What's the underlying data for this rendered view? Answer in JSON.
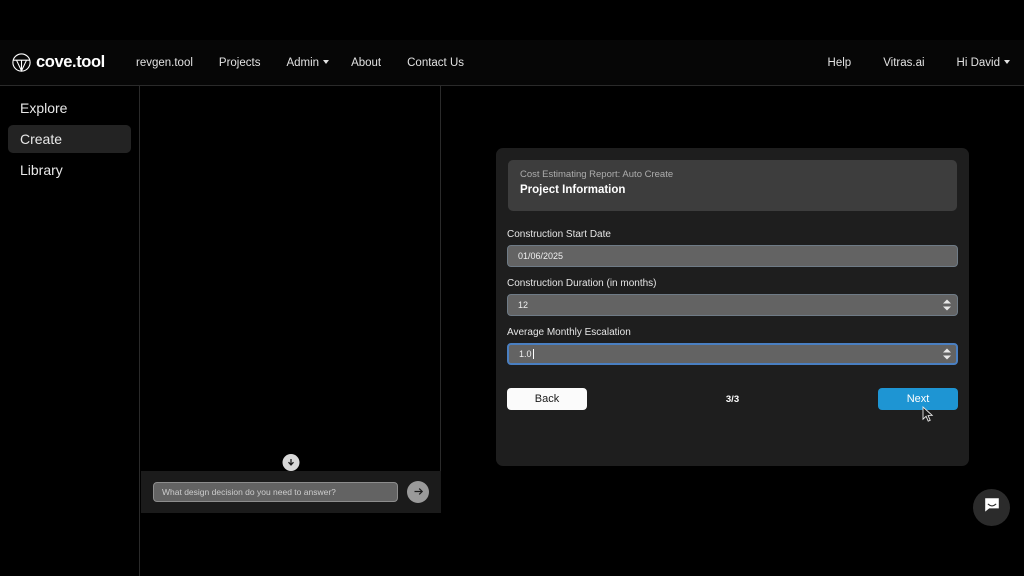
{
  "header": {
    "brand": "cove.tool",
    "brand_icon": "cove-logo-icon",
    "left_links": [
      {
        "label": "revgen.tool",
        "has_caret": false
      },
      {
        "label": "Projects",
        "has_caret": false
      },
      {
        "label": "Admin",
        "has_caret": true
      },
      {
        "label": "About",
        "has_caret": false
      },
      {
        "label": "Contact Us",
        "has_caret": false
      }
    ],
    "right_links": [
      {
        "label": "Help",
        "has_caret": false
      },
      {
        "label": "Vitras.ai",
        "has_caret": false
      },
      {
        "label": "Hi David",
        "has_caret": true
      }
    ]
  },
  "sidebar": {
    "items": [
      {
        "label": "Explore",
        "active": false
      },
      {
        "label": "Create",
        "active": true
      },
      {
        "label": "Library",
        "active": false
      }
    ]
  },
  "chat_panel": {
    "scroll_down_icon": "arrow-down-circle-icon",
    "input_placeholder": "What design decision do you need to answer?",
    "input_value": "",
    "send_icon": "arrow-right-icon"
  },
  "modal": {
    "subtitle": "Cost Estimating Report: Auto Create",
    "title": "Project Information",
    "fields": [
      {
        "label": "Construction Start Date",
        "value": "01/06/2025",
        "type": "date",
        "focused": false,
        "spinner": false
      },
      {
        "label": "Construction Duration (in months)",
        "value": "12",
        "type": "number",
        "focused": false,
        "spinner": true
      },
      {
        "label": "Average Monthly Escalation",
        "value": "1.0",
        "type": "number",
        "focused": true,
        "spinner": true
      }
    ],
    "back_label": "Back",
    "step_indicator": "3/3",
    "next_label": "Next"
  },
  "launcher": {
    "icon": "chat-bubble-icon"
  },
  "colors": {
    "page_background": "#000000",
    "card_background": "#1e1e1e",
    "card_header": "#3d3d3d",
    "input_background": "#636363",
    "accent_blue": "#1e95d3",
    "focus_border": "#4a7fc1",
    "sidebar_active": "#232323"
  }
}
